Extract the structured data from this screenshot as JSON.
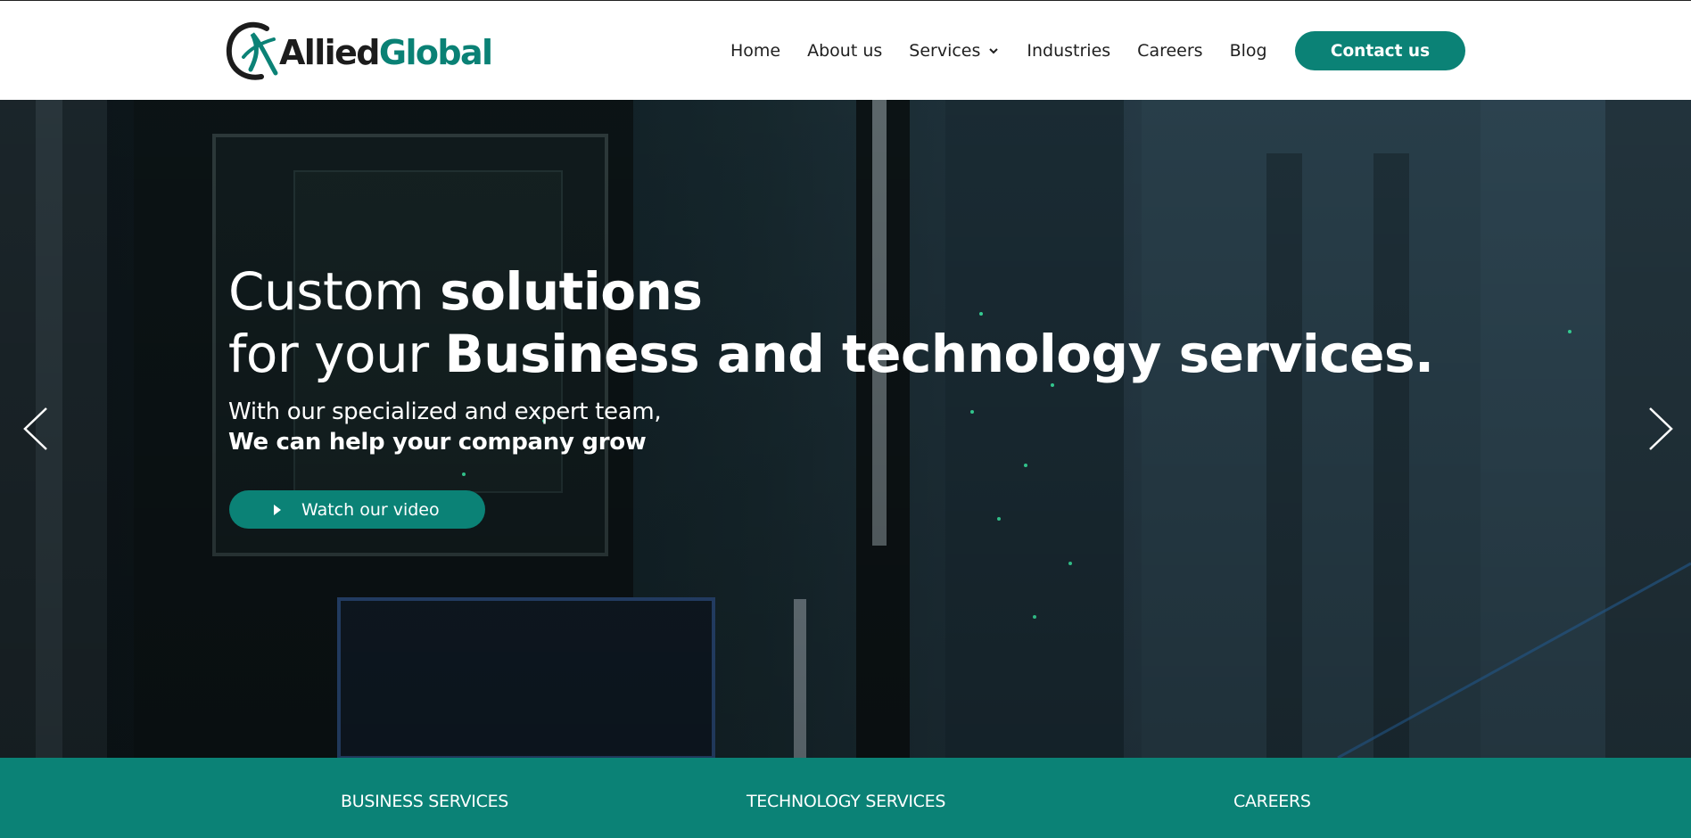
{
  "brand": {
    "name_part1": "Allied",
    "name_part2": "Global",
    "primary_color": "#0b8276",
    "dark_color": "#1c1c1c"
  },
  "nav": {
    "items": [
      {
        "label": "Home"
      },
      {
        "label": "About us"
      },
      {
        "label": "Services",
        "has_dropdown": true
      },
      {
        "label": "Industries"
      },
      {
        "label": "Careers"
      },
      {
        "label": "Blog"
      }
    ],
    "contact_label": "Contact us"
  },
  "hero": {
    "title_line1_light": "Custom ",
    "title_line1_bold": "solutions",
    "title_line2_light": "for your ",
    "title_line2_bold": "Business and technology services.",
    "subtitle_line1": "With our specialized and expert team,",
    "subtitle_line2": "We can help your company grow",
    "video_button_label": "Watch our video",
    "icons": {
      "prev": "chevron-left-icon",
      "next": "chevron-right-icon",
      "play": "play-icon"
    }
  },
  "band": {
    "items": [
      {
        "label": "BUSINESS SERVICES"
      },
      {
        "label": "TECHNOLOGY SERVICES"
      },
      {
        "label": "CAREERS"
      }
    ]
  }
}
